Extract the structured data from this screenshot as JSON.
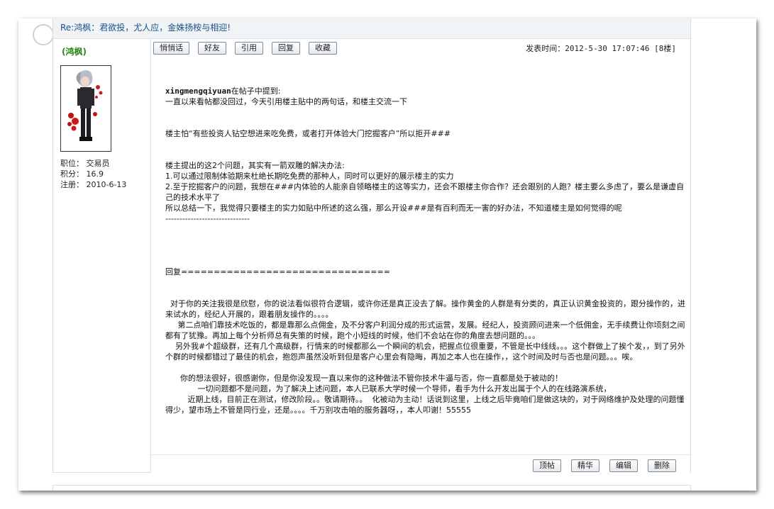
{
  "post": {
    "title": "Re:鸿枫：君欲投，尤人应，金姝扬桉与相迎!",
    "author": {
      "name": "(鸿枫)",
      "meta": [
        "职位： 交易员",
        "积分： 16.9",
        "注册： 2010-6-13"
      ]
    },
    "actions": [
      "悄悄话",
      "好友",
      "引用",
      "回复",
      "收藏"
    ],
    "post_time": "发表时间：2012-5-30 17:07:46 [8楼]",
    "body": {
      "quote_user": "xingmengqiyuan",
      "quote_intro": "在帖子中提到:",
      "lines": [
        "一直以来看帖都没回过，今天引用楼主贴中的两句话，和楼主交流一下",
        "",
        "",
        "楼主怕“有些投资人钻空想进来吃免费，或者打开体验大门挖掘客户”所以拒开###",
        "",
        "",
        "楼主提出的这2个问题，其实有一箭双雕的解决办法:",
        "1.可以通过限制体验期来杜绝长期吃免费的那种人，同时可以更好的展示楼主的实力",
        "2.至于挖掘客户的问题，我想在###内体验的人能亲自领略楼主的这等实力，还会不跟楼主你合作？还会跟别的人跑？楼主要么多虑了，要么是谦虚自己的技术水平了",
        "所以总结一下，我觉得只要楼主的实力如贴中所述的这么强，那么开设###是有百利而无一害的好办法，不知道楼主是如何觉得的呢",
        "------------------------------",
        "",
        "",
        "",
        "",
        "回复================================",
        "",
        "",
        "  对于你的关注我很是欣慰，你的说法看似很符合逻辑，或许你还是真正没去了解。操作黄金的人群是有分类的，真正认识黄金投资的，跟分操作的，进来试水的，经纪人开展的，跟着朋友操作的。。。。",
        "     第二点咱们靠技术吃饭的，都是靠那么点佣金，及不分客户利润分成的形式运营，发展。经纪人，投资顾问进来一个低佣金，无手续费让你顷刻之间都有了犹豫。再加上每个分析师总有失策的时候，跑个小短线的时候，他们不会站在你的角度去想问题的。。。",
        "    另外我#个超级群，还有几个高级群，行情来的时候都那么一个瞬间的机会，把握点位很重要，不管是长中线线。。。这个群做上了挨个发，，到了另外个群的时候都错过了最佳的机会，抱怨声虽然没听到但是客户心里会有隐晦，再加之本人也在操作，，这个时间及时与否也是问题。。。唉。",
        "",
        "      你的想法很好，很感谢你，但是你没发现一直以来你的这种做法不管你技术牛逼与否，你一直都是处于被动的！",
        "             一切问题都不是问题，为了解决上述问题，本人已联系大学时候一个导师，看手为什么开发出属于个人的在线路演系统，",
        "         近期上线，目前正在测试，修改阶段。。敬请期待。。  化被动为主动！话说到这里，上线之后毕竟咱们是做这块的，对于网络维护及处理的问题懂得少，望市场上不管是同行业，还是。。。。千万别攻击咱的服务器呀，，本人叩谢！55555"
      ]
    },
    "footer_actions": [
      "顶帖",
      "精华",
      "编辑",
      "删除"
    ]
  }
}
